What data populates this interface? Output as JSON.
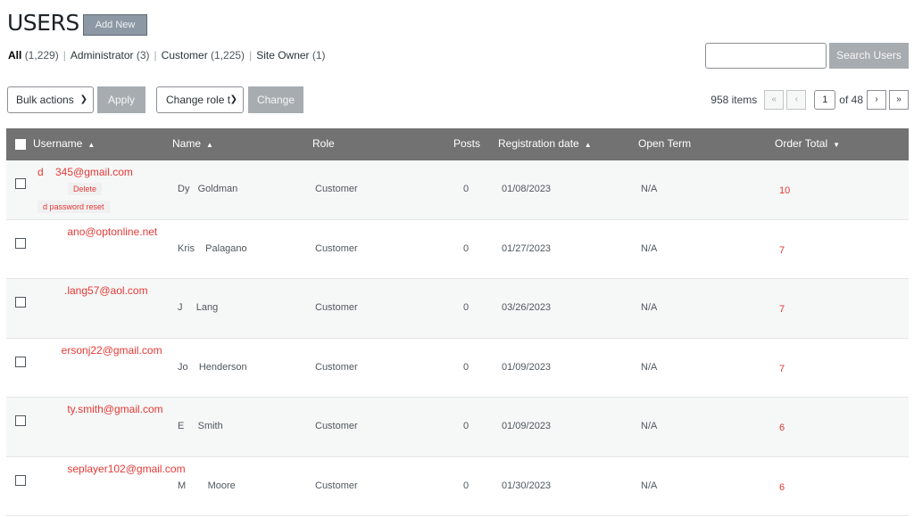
{
  "header": {
    "title": "USERS",
    "add_new": "Add New"
  },
  "filters": {
    "all": {
      "label": "All",
      "count": "(1,229)"
    },
    "administrator": {
      "label": "Administrator",
      "count": "(3)"
    },
    "customer": {
      "label": "Customer",
      "count": "(1,225)"
    },
    "site_owner": {
      "label": "Site Owner",
      "count": "(1)"
    },
    "separator": "|"
  },
  "search": {
    "value": "",
    "button": "Search Users"
  },
  "toolbar": {
    "bulk_actions": "Bulk actions",
    "apply": "Apply",
    "change_role": "Change role t",
    "change": "Change"
  },
  "pagination": {
    "items": "958 items",
    "first": "«",
    "prev": "‹",
    "next": "›",
    "last": "»",
    "current": "1",
    "of": "of 48"
  },
  "columns": {
    "username": "Username",
    "name": "Name",
    "role": "Role",
    "posts": "Posts",
    "registration": "Registration date",
    "open_term": "Open Term",
    "order_total": "Order Total"
  },
  "row_actions": {
    "delete": "Delete",
    "password_reset": "d password reset"
  },
  "rows": [
    {
      "email": "d    345@gmail.com",
      "name": "Dy   Goldman",
      "role": "Customer",
      "posts": "0",
      "date": "01/08/2023",
      "open_term": "N/A",
      "total": "10"
    },
    {
      "email": "          ano@optonline.net",
      "name": "Kris    Palagano",
      "role": "Customer",
      "posts": "0",
      "date": "01/27/2023",
      "open_term": "N/A",
      "total": "7"
    },
    {
      "email": "         .lang57@aol.com",
      "name": "J     Lang",
      "role": "Customer",
      "posts": "0",
      "date": "03/26/2023",
      "open_term": "N/A",
      "total": "7"
    },
    {
      "email": "        ersonj22@gmail.com",
      "name": "Jo    Henderson",
      "role": "Customer",
      "posts": "0",
      "date": "01/09/2023",
      "open_term": "N/A",
      "total": "7"
    },
    {
      "email": "          ty.smith@gmail.com",
      "name": "E     Smith",
      "role": "Customer",
      "posts": "0",
      "date": "01/09/2023",
      "open_term": "N/A",
      "total": "6"
    },
    {
      "email": "          seplayer102@gmail.com",
      "name": "M        Moore",
      "role": "Customer",
      "posts": "0",
      "date": "01/30/2023",
      "open_term": "N/A",
      "total": "6"
    }
  ]
}
